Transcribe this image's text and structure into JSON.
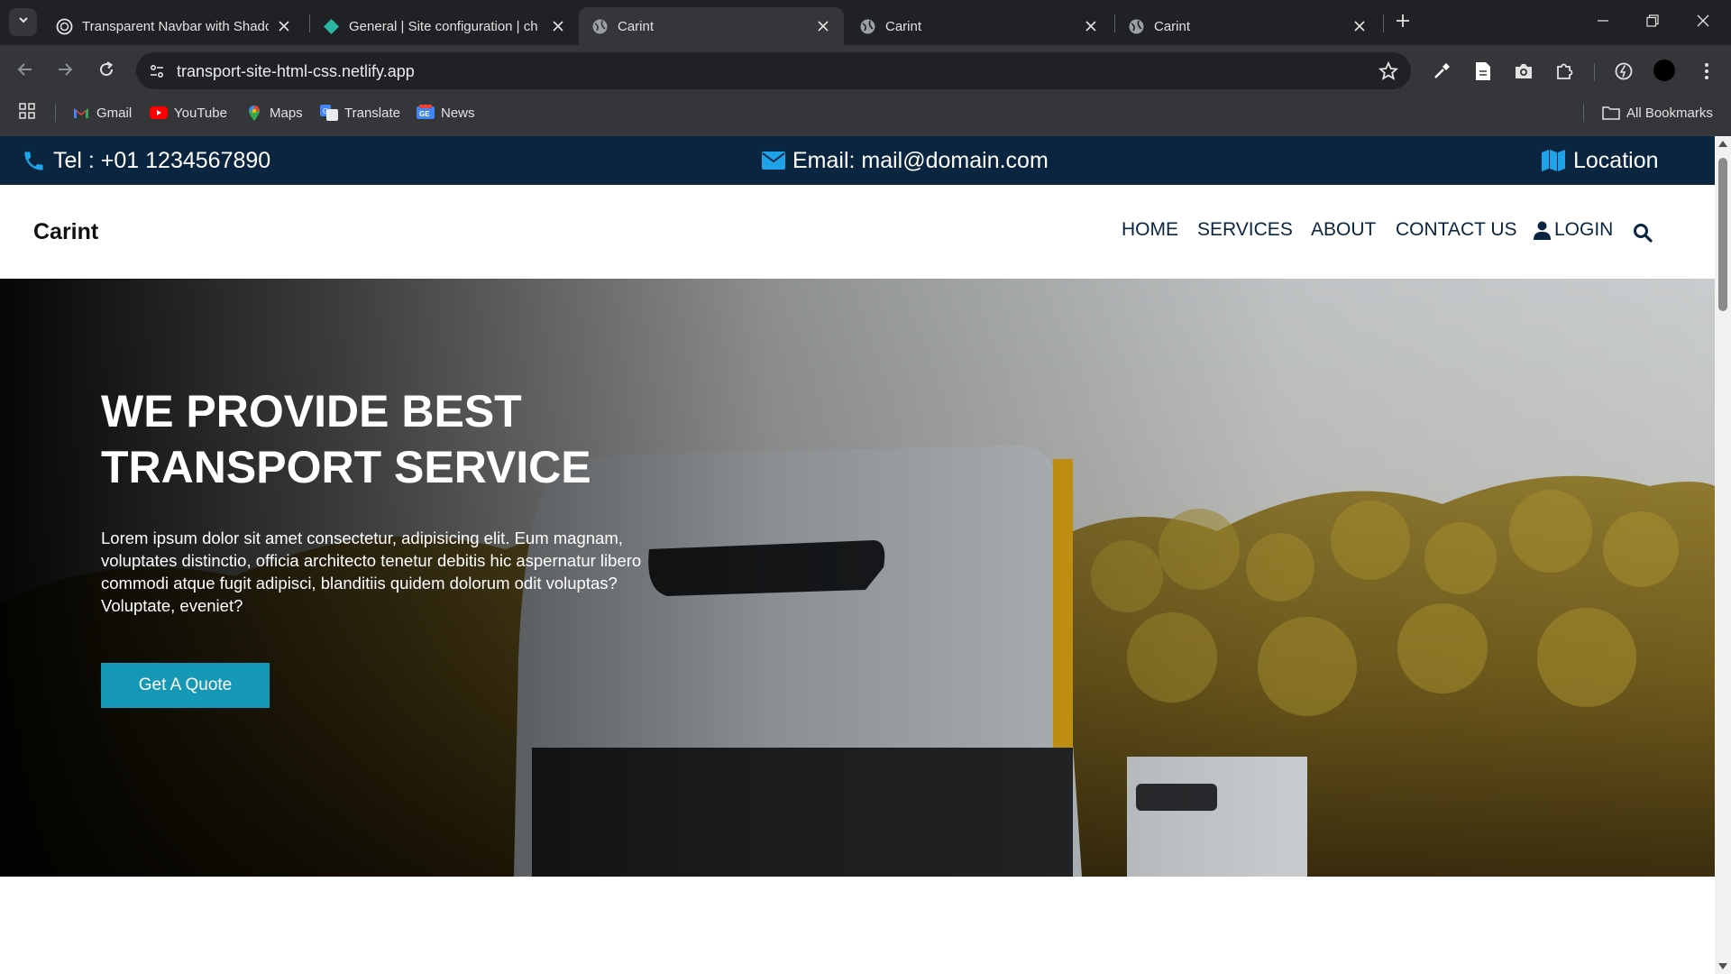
{
  "browser": {
    "tabs": [
      {
        "title": "Transparent Navbar with Shado",
        "active": false,
        "favicon": "circle-logo-icon"
      },
      {
        "title": "General | Site configuration | ch",
        "active": false,
        "favicon": "netlify-diamond-icon"
      },
      {
        "title": "Carint",
        "active": true,
        "favicon": "globe-icon"
      },
      {
        "title": "Carint",
        "active": false,
        "favicon": "globe-icon"
      },
      {
        "title": "Carint",
        "active": false,
        "favicon": "globe-icon"
      }
    ],
    "url": "transport-site-html-css.netlify.app",
    "bookmarks": [
      {
        "label": "Gmail",
        "icon": "gmail-icon"
      },
      {
        "label": "YouTube",
        "icon": "youtube-icon"
      },
      {
        "label": "Maps",
        "icon": "maps-icon"
      },
      {
        "label": "Translate",
        "icon": "translate-icon"
      },
      {
        "label": "News",
        "icon": "news-icon"
      }
    ],
    "all_bookmarks": "All Bookmarks"
  },
  "site": {
    "topbar": {
      "tel": "Tel : +01 1234567890",
      "email": "Email: mail@domain.com",
      "location": "Location"
    },
    "brand": "Carint",
    "nav": [
      "HOME",
      "SERVICES",
      "ABOUT",
      "CONTACT US",
      "LOGIN"
    ],
    "hero": {
      "title_line1": "WE PROVIDE BEST",
      "title_line2": "TRANSPORT SERVICE",
      "text": "Lorem ipsum dolor sit amet consectetur, adipisicing elit. Eum magnam, voluptates distinctio, officia architecto tenetur debitis hic aspernatur libero commodi atque fugit adipisci, blanditiis quidem dolorum odit voluptas? Voluptate, eveniet?",
      "button": "Get A Quote"
    }
  },
  "colors": {
    "topbar_bg": "#0a2540",
    "accent_icon": "#1fa3e8",
    "button_bg": "#1597b6",
    "nav_text": "#0a2540"
  }
}
